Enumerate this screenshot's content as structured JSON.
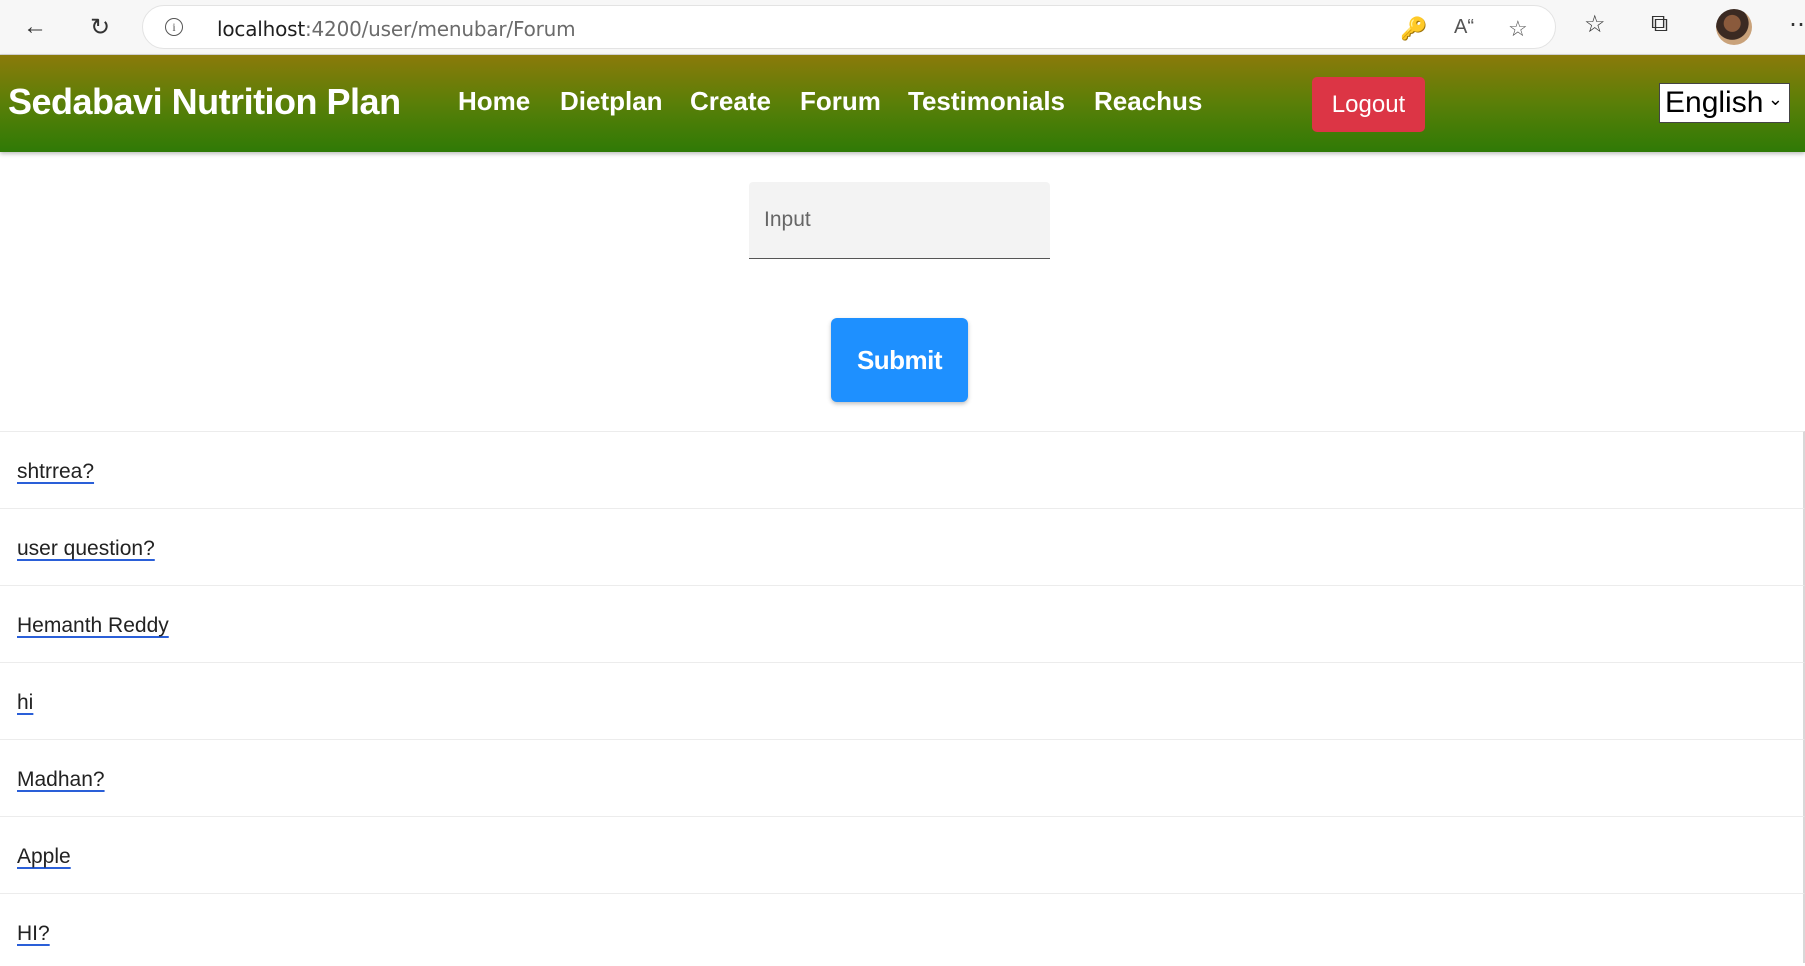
{
  "browser": {
    "url_host": "localhost",
    "url_path": ":4200/user/menubar/Forum"
  },
  "navbar": {
    "brand": "Sedabavi Nutrition Plan",
    "links": [
      "Home",
      "Dietplan",
      "Create",
      "Forum",
      "Testimonials",
      "Reachus"
    ],
    "logout_label": "Logout",
    "language": "English",
    "colors": {
      "gradient_top": "#8b7a0a",
      "gradient_bottom": "#2f7a06",
      "logout": "#dc3545"
    }
  },
  "form": {
    "input_placeholder": "Input",
    "submit_label": "Submit",
    "submit_color": "#1e90ff"
  },
  "questions": [
    "shtrrea?",
    "user question?",
    "Hemanth Reddy",
    "hi",
    "Madhan?",
    "Apple",
    "HI?"
  ]
}
